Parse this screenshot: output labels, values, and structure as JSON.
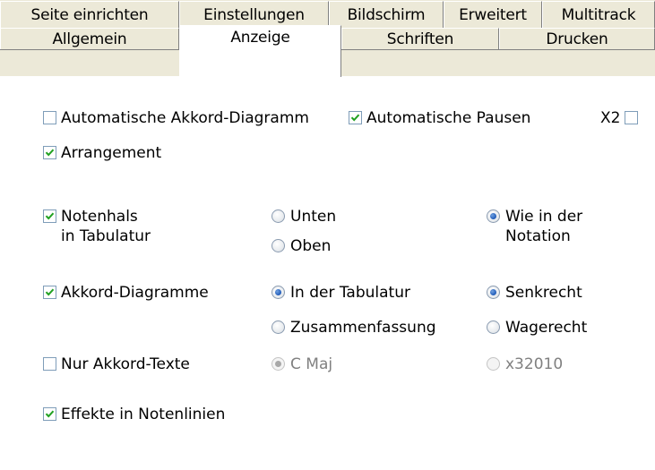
{
  "tabs_row1": [
    "Seite einrichten",
    "Einstellungen",
    "Bildschirm",
    "Erweitert",
    "Multitrack"
  ],
  "tabs_row2": [
    "Allgemein",
    "Anzeige",
    "Schriften",
    "Drucken"
  ],
  "active_tab": "Anzeige",
  "options": {
    "auto_chord": {
      "label": "Automatische Akkord-Diagramm",
      "checked": false
    },
    "auto_rests": {
      "label": "Automatische Pausen",
      "checked": true
    },
    "x2": {
      "label": "X2",
      "checked": false
    },
    "arrangement": {
      "label": "Arrangement",
      "checked": true
    },
    "stems": {
      "label_line1": "Notenhals",
      "label_line2": "in Tabulatur",
      "checked": true
    },
    "stems_down": {
      "label": "Unten",
      "selected": false
    },
    "stems_up": {
      "label": "Oben",
      "selected": false
    },
    "stems_notation": {
      "label_line1": "Wie in der",
      "label_line2": "Notation",
      "selected": true
    },
    "chord_diagrams": {
      "label": "Akkord-Diagramme",
      "checked": true
    },
    "in_tab": {
      "label": "In der Tabulatur",
      "selected": true
    },
    "summary": {
      "label": "Zusammenfassung",
      "selected": false
    },
    "vertical": {
      "label": "Senkrecht",
      "selected": true
    },
    "horizontal": {
      "label": "Wagerecht",
      "selected": false
    },
    "chord_text_only": {
      "label": "Nur Akkord-Texte",
      "checked": false
    },
    "cmaj": {
      "label": "C Maj",
      "selected": true,
      "disabled": true
    },
    "x32010": {
      "label": "x32010",
      "selected": false,
      "disabled": true
    },
    "effects": {
      "label": "Effekte in Notenlinien",
      "checked": true
    }
  },
  "colors": {
    "dialog_bg": "#ece9d8",
    "panel_bg": "#ffffff",
    "accent": "#1f5ab8",
    "check": "#21a121"
  }
}
